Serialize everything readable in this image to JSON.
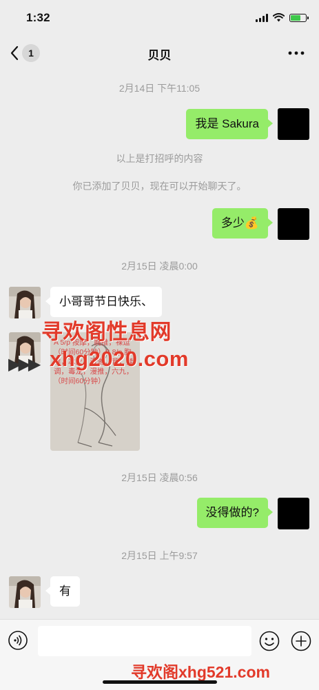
{
  "status": {
    "time": "1:32"
  },
  "nav": {
    "back_badge": "1",
    "title": "贝贝"
  },
  "messages": {
    "t1": "2月14日 下午11:05",
    "m1": "我是 Sakura",
    "sys1": "以上是打招呼的内容",
    "sys2": "你已添加了贝贝，现在可以开始聊天了。",
    "m2": "多少💰",
    "t2": "2月15日 凌晨0:00",
    "m3": "小哥哥节日快乐、",
    "img_text": "A 5/p 按摩，胸推，裸逗（时间60分钟）B 8/p 胸推，冰火，漫游，背，揉调，毒龙，漫推，六九，（时间60分钟）",
    "t3": "2月15日 凌晨0:56",
    "m4": "没得做的?",
    "t4": "2月15日 上午9:57",
    "m5": "有"
  },
  "watermarks": {
    "w1": "寻欢阁性息网",
    "w2": "xhg2020.com",
    "w3": "寻欢阁xhg521.com"
  },
  "input": {
    "placeholder": ""
  },
  "colors": {
    "outgoing_bubble": "#95ec69",
    "background": "#ededed",
    "watermark": "#e23a2a"
  },
  "icons": [
    "back-chevron-icon",
    "more-dots-icon",
    "voice-icon",
    "emoji-icon",
    "plus-icon",
    "signal-icon",
    "wifi-icon",
    "battery-icon"
  ]
}
